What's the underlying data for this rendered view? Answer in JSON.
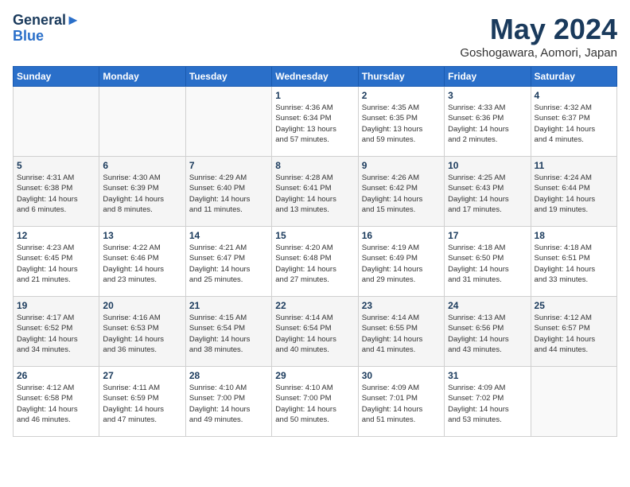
{
  "logo": {
    "line1": "General",
    "line2": "Blue"
  },
  "title": "May 2024",
  "subtitle": "Goshogawara, Aomori, Japan",
  "days_of_week": [
    "Sunday",
    "Monday",
    "Tuesday",
    "Wednesday",
    "Thursday",
    "Friday",
    "Saturday"
  ],
  "weeks": [
    [
      {
        "day": "",
        "info": ""
      },
      {
        "day": "",
        "info": ""
      },
      {
        "day": "",
        "info": ""
      },
      {
        "day": "1",
        "info": "Sunrise: 4:36 AM\nSunset: 6:34 PM\nDaylight: 13 hours and 57 minutes."
      },
      {
        "day": "2",
        "info": "Sunrise: 4:35 AM\nSunset: 6:35 PM\nDaylight: 13 hours and 59 minutes."
      },
      {
        "day": "3",
        "info": "Sunrise: 4:33 AM\nSunset: 6:36 PM\nDaylight: 14 hours and 2 minutes."
      },
      {
        "day": "4",
        "info": "Sunrise: 4:32 AM\nSunset: 6:37 PM\nDaylight: 14 hours and 4 minutes."
      }
    ],
    [
      {
        "day": "5",
        "info": "Sunrise: 4:31 AM\nSunset: 6:38 PM\nDaylight: 14 hours and 6 minutes."
      },
      {
        "day": "6",
        "info": "Sunrise: 4:30 AM\nSunset: 6:39 PM\nDaylight: 14 hours and 8 minutes."
      },
      {
        "day": "7",
        "info": "Sunrise: 4:29 AM\nSunset: 6:40 PM\nDaylight: 14 hours and 11 minutes."
      },
      {
        "day": "8",
        "info": "Sunrise: 4:28 AM\nSunset: 6:41 PM\nDaylight: 14 hours and 13 minutes."
      },
      {
        "day": "9",
        "info": "Sunrise: 4:26 AM\nSunset: 6:42 PM\nDaylight: 14 hours and 15 minutes."
      },
      {
        "day": "10",
        "info": "Sunrise: 4:25 AM\nSunset: 6:43 PM\nDaylight: 14 hours and 17 minutes."
      },
      {
        "day": "11",
        "info": "Sunrise: 4:24 AM\nSunset: 6:44 PM\nDaylight: 14 hours and 19 minutes."
      }
    ],
    [
      {
        "day": "12",
        "info": "Sunrise: 4:23 AM\nSunset: 6:45 PM\nDaylight: 14 hours and 21 minutes."
      },
      {
        "day": "13",
        "info": "Sunrise: 4:22 AM\nSunset: 6:46 PM\nDaylight: 14 hours and 23 minutes."
      },
      {
        "day": "14",
        "info": "Sunrise: 4:21 AM\nSunset: 6:47 PM\nDaylight: 14 hours and 25 minutes."
      },
      {
        "day": "15",
        "info": "Sunrise: 4:20 AM\nSunset: 6:48 PM\nDaylight: 14 hours and 27 minutes."
      },
      {
        "day": "16",
        "info": "Sunrise: 4:19 AM\nSunset: 6:49 PM\nDaylight: 14 hours and 29 minutes."
      },
      {
        "day": "17",
        "info": "Sunrise: 4:18 AM\nSunset: 6:50 PM\nDaylight: 14 hours and 31 minutes."
      },
      {
        "day": "18",
        "info": "Sunrise: 4:18 AM\nSunset: 6:51 PM\nDaylight: 14 hours and 33 minutes."
      }
    ],
    [
      {
        "day": "19",
        "info": "Sunrise: 4:17 AM\nSunset: 6:52 PM\nDaylight: 14 hours and 34 minutes."
      },
      {
        "day": "20",
        "info": "Sunrise: 4:16 AM\nSunset: 6:53 PM\nDaylight: 14 hours and 36 minutes."
      },
      {
        "day": "21",
        "info": "Sunrise: 4:15 AM\nSunset: 6:54 PM\nDaylight: 14 hours and 38 minutes."
      },
      {
        "day": "22",
        "info": "Sunrise: 4:14 AM\nSunset: 6:54 PM\nDaylight: 14 hours and 40 minutes."
      },
      {
        "day": "23",
        "info": "Sunrise: 4:14 AM\nSunset: 6:55 PM\nDaylight: 14 hours and 41 minutes."
      },
      {
        "day": "24",
        "info": "Sunrise: 4:13 AM\nSunset: 6:56 PM\nDaylight: 14 hours and 43 minutes."
      },
      {
        "day": "25",
        "info": "Sunrise: 4:12 AM\nSunset: 6:57 PM\nDaylight: 14 hours and 44 minutes."
      }
    ],
    [
      {
        "day": "26",
        "info": "Sunrise: 4:12 AM\nSunset: 6:58 PM\nDaylight: 14 hours and 46 minutes."
      },
      {
        "day": "27",
        "info": "Sunrise: 4:11 AM\nSunset: 6:59 PM\nDaylight: 14 hours and 47 minutes."
      },
      {
        "day": "28",
        "info": "Sunrise: 4:10 AM\nSunset: 7:00 PM\nDaylight: 14 hours and 49 minutes."
      },
      {
        "day": "29",
        "info": "Sunrise: 4:10 AM\nSunset: 7:00 PM\nDaylight: 14 hours and 50 minutes."
      },
      {
        "day": "30",
        "info": "Sunrise: 4:09 AM\nSunset: 7:01 PM\nDaylight: 14 hours and 51 minutes."
      },
      {
        "day": "31",
        "info": "Sunrise: 4:09 AM\nSunset: 7:02 PM\nDaylight: 14 hours and 53 minutes."
      },
      {
        "day": "",
        "info": ""
      }
    ]
  ]
}
